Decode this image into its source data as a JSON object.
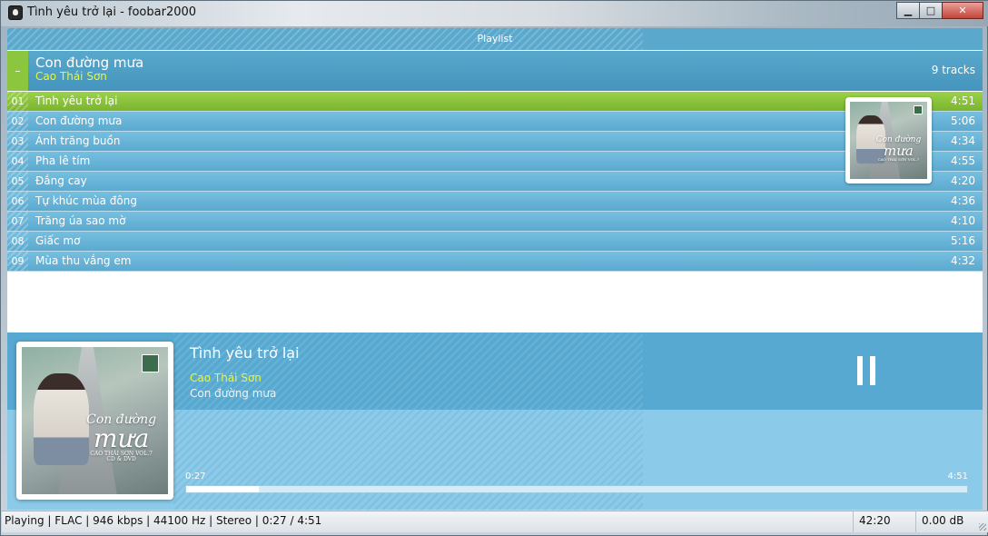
{
  "window": {
    "title": "Tình yêu trở lại - foobar2000",
    "controls": {
      "minimize": "▁",
      "maximize": "□",
      "close": "✕"
    }
  },
  "playlist": {
    "header": "Playlist",
    "group": {
      "collapse_symbol": "–",
      "album": "Con đường mưa",
      "artist": "Cao Thái Sơn",
      "count": "9 tracks"
    },
    "tracks": [
      {
        "num": "01",
        "title": "Tình yêu trở lại",
        "duration": "4:51",
        "playing": true
      },
      {
        "num": "02",
        "title": "Con đường mưa",
        "duration": "5:06"
      },
      {
        "num": "03",
        "title": "Ánh trăng buồn",
        "duration": "4:34"
      },
      {
        "num": "04",
        "title": "Pha lê tím",
        "duration": "4:55"
      },
      {
        "num": "05",
        "title": "Đắng cay",
        "duration": "4:20"
      },
      {
        "num": "06",
        "title": "Tự khúc mùa đông",
        "duration": "4:36"
      },
      {
        "num": "07",
        "title": "Trăng úa sao mờ",
        "duration": "4:10"
      },
      {
        "num": "08",
        "title": "Giấc mơ",
        "duration": "5:16"
      },
      {
        "num": "09",
        "title": "Mùa thu vắng em",
        "duration": "4:32"
      }
    ]
  },
  "cover": {
    "script_line1": "Con đường",
    "script_line2": "mưa",
    "caption": "CAO THÁI SƠN VOL.7",
    "caption2": "CD & DVD"
  },
  "now_playing": {
    "title": "Tình yêu trở lại",
    "artist": "Cao Thái Sơn",
    "album": "Con đường mưa",
    "state_icon": "pause-icon",
    "time_current": "0:27",
    "time_total": "4:51",
    "progress_fraction": 0.093
  },
  "statusbar": {
    "info": "Playing | FLAC | 946 kbps | 44100 Hz | Stereo | 0:27 / 4:51",
    "total_time": "42:20",
    "volume": "0.00 dB"
  },
  "colors": {
    "accent_blue": "#5eafd6",
    "active_green": "#8cc63f",
    "artist_yellow": "#e9f53a"
  }
}
